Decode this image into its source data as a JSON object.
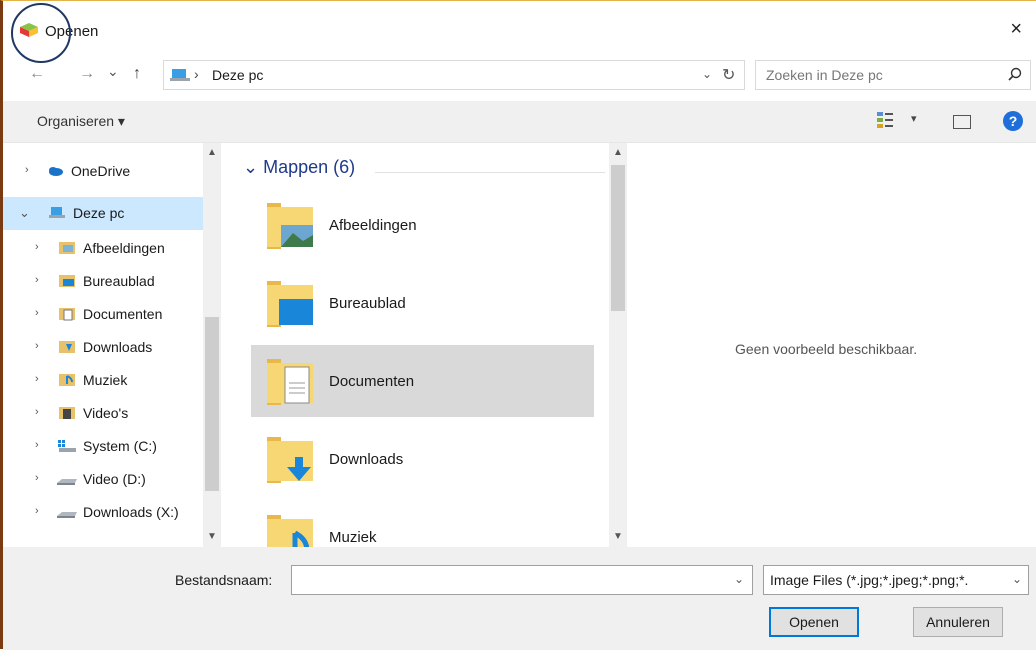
{
  "window": {
    "title": "Openen",
    "close": "×"
  },
  "nav": {
    "back": "←",
    "forward": "→",
    "recent": "⌄",
    "up": "↑"
  },
  "address": {
    "sep": "›",
    "location": "Deze pc",
    "dropdown": "⌄",
    "refresh": "↻"
  },
  "search": {
    "placeholder": "Zoeken in Deze pc"
  },
  "toolbar": {
    "organise": "Organiseren ▾",
    "view_drop": "▾",
    "help": "?"
  },
  "sidebar": {
    "items": [
      {
        "label": "OneDrive",
        "chevron": "›",
        "icon": "onedrive-icon"
      },
      {
        "label": "Deze pc",
        "chevron": "⌄",
        "icon": "pc-icon",
        "selected": true
      },
      {
        "label": "Afbeeldingen",
        "chevron": "›",
        "icon": "pictures-icon"
      },
      {
        "label": "Bureaublad",
        "chevron": "›",
        "icon": "desktop-icon"
      },
      {
        "label": "Documenten",
        "chevron": "›",
        "icon": "documents-icon"
      },
      {
        "label": "Downloads",
        "chevron": "›",
        "icon": "downloads-icon"
      },
      {
        "label": "Muziek",
        "chevron": "›",
        "icon": "music-icon"
      },
      {
        "label": "Video's",
        "chevron": "›",
        "icon": "video-icon"
      },
      {
        "label": "System (C:)",
        "chevron": "›",
        "icon": "system-drive-icon"
      },
      {
        "label": "Video (D:)",
        "chevron": "›",
        "icon": "drive-icon"
      },
      {
        "label": "Downloads (X:)",
        "chevron": "›",
        "icon": "drive-icon"
      }
    ],
    "scroll_up": "▲",
    "scroll_down": "▼"
  },
  "main": {
    "group": "⌄ Mappen (6)",
    "folders": [
      {
        "label": "Afbeeldingen",
        "icon": "pictures-folder-icon"
      },
      {
        "label": "Bureaublad",
        "icon": "desktop-folder-icon"
      },
      {
        "label": "Documenten",
        "icon": "documents-folder-icon",
        "selected": true
      },
      {
        "label": "Downloads",
        "icon": "downloads-folder-icon"
      },
      {
        "label": "Muziek",
        "icon": "music-folder-icon"
      }
    ]
  },
  "preview": {
    "text": "Geen voorbeeld beschikbaar."
  },
  "footer": {
    "filename_label": "Bestandsnaam:",
    "filename_value": "",
    "dropdown": "⌄",
    "filetype": "Image Files (*.jpg;*.jpeg;*.png;*.",
    "open": "Openen",
    "cancel": "Annuleren"
  },
  "colors": {
    "accent": "#0078d7",
    "selection": "#cce8ff",
    "group_header": "#1e3a8a"
  }
}
